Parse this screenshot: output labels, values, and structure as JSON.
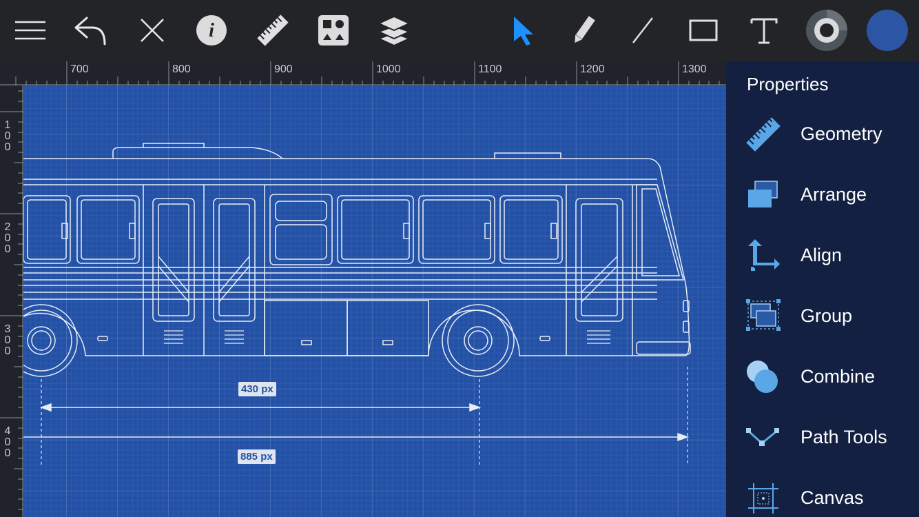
{
  "toolbar": {
    "left_tools": [
      "menu-icon",
      "undo-icon",
      "close-icon",
      "info-icon",
      "ruler-icon",
      "shapes-icon",
      "layers-icon"
    ],
    "right_tools": [
      "select-arrow-icon",
      "pencil-icon",
      "line-icon",
      "rectangle-icon",
      "text-icon",
      "stroke-color-icon",
      "fill-color-icon"
    ],
    "accent_color": "#1e90ff",
    "fill_color": "#2c55a3"
  },
  "ruler": {
    "top_labels": [
      "700",
      "800",
      "900",
      "1000",
      "1100",
      "1200",
      "1300"
    ],
    "left_labels": [
      "100",
      "200",
      "300",
      "400"
    ]
  },
  "canvas": {
    "background_color": "#2351a6",
    "dimension_1": "430 px",
    "dimension_2": "885 px"
  },
  "properties": {
    "title": "Properties",
    "items": [
      {
        "label": "Geometry",
        "icon": "geometry-ruler-icon"
      },
      {
        "label": "Arrange",
        "icon": "arrange-icon"
      },
      {
        "label": "Align",
        "icon": "align-icon"
      },
      {
        "label": "Group",
        "icon": "group-icon"
      },
      {
        "label": "Combine",
        "icon": "combine-icon"
      },
      {
        "label": "Path Tools",
        "icon": "path-tools-icon"
      },
      {
        "label": "Canvas",
        "icon": "canvas-icon"
      }
    ]
  }
}
